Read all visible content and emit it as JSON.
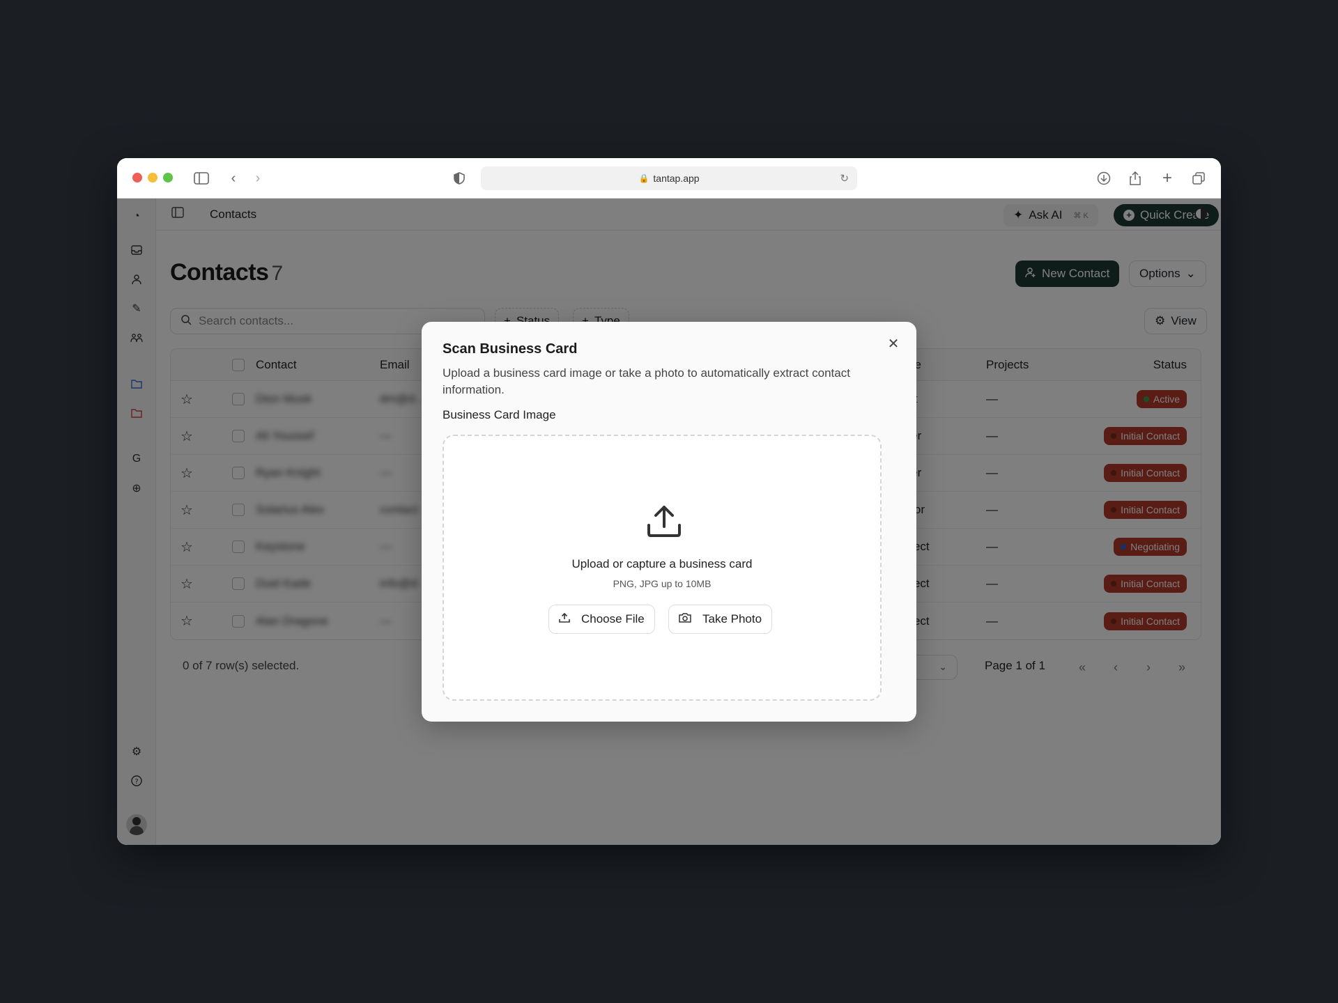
{
  "browser": {
    "url": "tantap.app"
  },
  "topbar": {
    "breadcrumb": "Contacts",
    "ask_ai_label": "Ask AI",
    "ask_ai_shortcut": "⌘ K",
    "quick_create_label": "Quick Create"
  },
  "page": {
    "title": "Contacts",
    "count": "7",
    "new_contact_label": "New Contact",
    "options_label": "Options",
    "view_label": "View"
  },
  "search": {
    "placeholder": "Search contacts..."
  },
  "filters": {
    "status_label": "Status",
    "type_label": "Type"
  },
  "table": {
    "headers": {
      "contact": "Contact",
      "email": "Email",
      "type": "pe",
      "projects": "Projects",
      "status": "Status"
    },
    "rows": [
      {
        "name": "Dion Musk",
        "email": "dm@d...",
        "type": "ent",
        "projects": "—",
        "status": "Active"
      },
      {
        "name": "Ali Youssef",
        "email": "—",
        "type": "tner",
        "projects": "—",
        "status": "Initial Contact"
      },
      {
        "name": "Ryan Knight",
        "email": "—",
        "type": "tner",
        "projects": "—",
        "status": "Initial Contact"
      },
      {
        "name": "Solarius Alex",
        "email": "contact",
        "type": "ndor",
        "projects": "—",
        "status": "Initial Contact"
      },
      {
        "name": "Keystone",
        "email": "—",
        "type": "spect",
        "projects": "—",
        "status": "Negotiating"
      },
      {
        "name": "Duel Kade",
        "email": "info@d",
        "type": "spect",
        "projects": "—",
        "status": "Initial Contact"
      },
      {
        "name": "Alan Dragone",
        "email": "—",
        "type": "spect",
        "projects": "—",
        "status": "Initial Contact"
      }
    ]
  },
  "footer": {
    "selection": "0 of 7 row(s) selected.",
    "page_label": "Page 1 of 1"
  },
  "modal": {
    "title": "Scan Business Card",
    "description": "Upload a business card image or take a photo to automatically extract contact information.",
    "field_label": "Business Card Image",
    "dropzone_title": "Upload or capture a business card",
    "dropzone_sub": "PNG, JPG up to 10MB",
    "choose_file_label": "Choose File",
    "take_photo_label": "Take Photo"
  },
  "colors": {
    "brand": "#1f3b35",
    "badge_active": "#b23a2a",
    "badge_initial": "#b23a2a",
    "badge_negotiating": "#b23a2a",
    "dot_active": "#2ea44f",
    "dot_negotiating": "#2f5fd6"
  }
}
